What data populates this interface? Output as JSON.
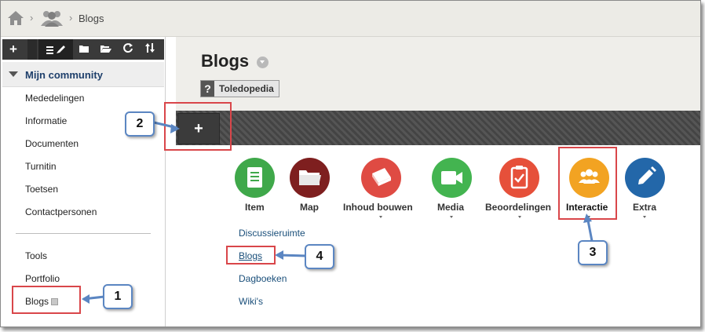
{
  "breadcrumb": {
    "current": "Blogs",
    "sep": "›"
  },
  "toolbar": {
    "plus": "+"
  },
  "sidebar": {
    "community": "Mijn community",
    "items": [
      "Mededelingen",
      "Informatie",
      "Documenten",
      "Turnitin",
      "Toetsen",
      "Contactpersonen"
    ],
    "tools": [
      "Tools",
      "Portfolio",
      "Blogs"
    ]
  },
  "page": {
    "title": "Blogs",
    "tag_q": "?",
    "tag": "Toledopedia"
  },
  "content": {
    "plus": "+",
    "items": [
      {
        "label": "Item",
        "color": "#3fa84a",
        "icon": "document-icon"
      },
      {
        "label": "Map",
        "color": "#7e1f1f",
        "icon": "folder-icon"
      },
      {
        "label": "Inhoud bouwen",
        "color": "#df4b43",
        "icon": "book-icon"
      },
      {
        "label": "Media",
        "color": "#43b450",
        "icon": "video-camera-icon"
      },
      {
        "label": "Beoordelingen",
        "color": "#e6503a",
        "icon": "clipboard-check-icon"
      },
      {
        "label": "Interactie",
        "color": "#f2a322",
        "icon": "people-icon"
      },
      {
        "label": "Extra",
        "color": "#2367a9",
        "icon": "pencil-icon"
      }
    ],
    "submenu": [
      "Discussieruimte",
      "Blogs",
      "Dagboeken",
      "Wiki's"
    ]
  },
  "annotations": {
    "c1": "1",
    "c2": "2",
    "c3": "3",
    "c4": "4",
    "highlight_color": "#d9464a",
    "callout_color": "#5b86c2"
  }
}
